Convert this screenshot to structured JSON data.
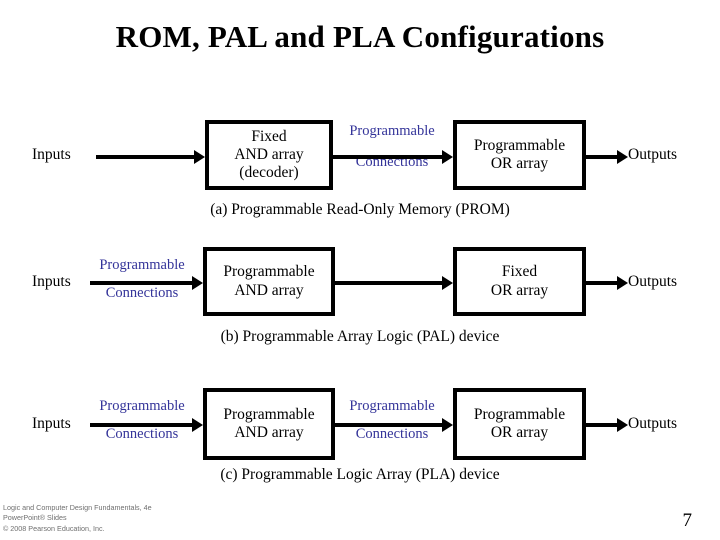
{
  "slide": {
    "title": "ROM, PAL and PLA Configurations",
    "page_number": "7",
    "accent_color": "#333399"
  },
  "rows": [
    {
      "id": "prom",
      "input_label": "Inputs",
      "output_label": "Outputs",
      "input_connection": null,
      "box1": {
        "line1": "Fixed",
        "line2": "AND array",
        "line3": "(decoder)"
      },
      "mid_connection": {
        "line1": "Programmable",
        "line2": "Connections"
      },
      "box2": {
        "line1": "Programmable",
        "line2": "OR array",
        "line3": ""
      },
      "caption": "(a) Programmable Read-Only Memory (PROM)"
    },
    {
      "id": "pal",
      "input_label": "Inputs",
      "output_label": "Outputs",
      "input_connection": {
        "line1": "Programmable",
        "line2": "Connections"
      },
      "box1": {
        "line1": "Programmable",
        "line2": "AND array",
        "line3": ""
      },
      "mid_connection": null,
      "box2": {
        "line1": "Fixed",
        "line2": "OR array",
        "line3": ""
      },
      "caption": "(b) Programmable Array Logic (PAL) device"
    },
    {
      "id": "pla",
      "input_label": "Inputs",
      "output_label": "Outputs",
      "input_connection": {
        "line1": "Programmable",
        "line2": "Connections"
      },
      "box1": {
        "line1": "Programmable",
        "line2": "AND array",
        "line3": ""
      },
      "mid_connection": {
        "line1": "Programmable",
        "line2": "Connections"
      },
      "box2": {
        "line1": "Programmable",
        "line2": "OR array",
        "line3": ""
      },
      "caption": "(c) Programmable Logic Array (PLA) device"
    }
  ],
  "footer": {
    "line1": "Logic and Computer Design Fundamentals, 4e",
    "line2": "PowerPoint® Slides",
    "line3": "© 2008 Pearson Education, Inc."
  }
}
